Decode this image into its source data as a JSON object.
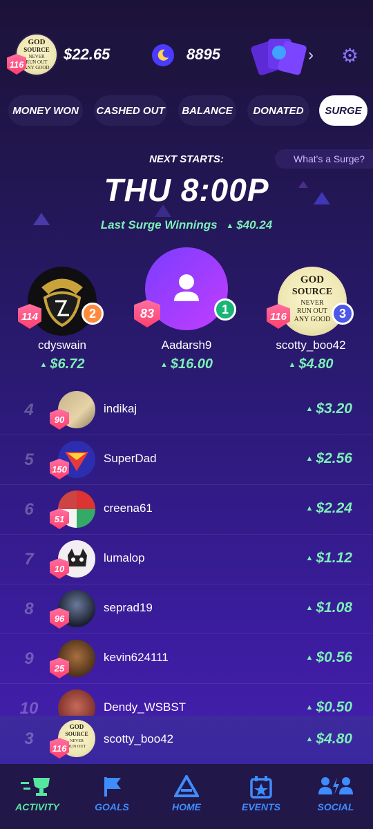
{
  "header": {
    "user_level": "116",
    "balance": "$22.65",
    "coins": "8895"
  },
  "tabs": [
    {
      "label": "MONEY WON",
      "active": false
    },
    {
      "label": "CASHED OUT",
      "active": false
    },
    {
      "label": "BALANCE",
      "active": false
    },
    {
      "label": "DONATED",
      "active": false
    },
    {
      "label": "SURGE",
      "active": true
    }
  ],
  "surge": {
    "help_link": "What's a Surge?",
    "next_label": "NEXT STARTS:",
    "next_time": "THU 8:00P",
    "last_label": "Last Surge Winnings",
    "last_amount": "$40.24"
  },
  "podium": [
    {
      "rank": "1",
      "name": "Aadarsh9",
      "level": "83",
      "amount": "$16.00"
    },
    {
      "rank": "2",
      "name": "cdyswain",
      "level": "114",
      "amount": "$6.72"
    },
    {
      "rank": "3",
      "name": "scotty_boo42",
      "level": "116",
      "amount": "$4.80"
    }
  ],
  "leaderboard": [
    {
      "rank": "4",
      "name": "indikaj",
      "level": "90",
      "amount": "$3.20"
    },
    {
      "rank": "5",
      "name": "SuperDad",
      "level": "150",
      "amount": "$2.56"
    },
    {
      "rank": "6",
      "name": "creena61",
      "level": "51",
      "amount": "$2.24"
    },
    {
      "rank": "7",
      "name": "lumalop",
      "level": "10",
      "amount": "$1.12"
    },
    {
      "rank": "8",
      "name": "seprad19",
      "level": "96",
      "amount": "$1.08"
    },
    {
      "rank": "9",
      "name": "kevin624111",
      "level": "25",
      "amount": "$0.56"
    },
    {
      "rank": "10",
      "name": "Dendy_WSBST",
      "level": "",
      "amount": "$0.50"
    }
  ],
  "pinned_self": {
    "rank": "3",
    "name": "scotty_boo42",
    "level": "116",
    "amount": "$4.80"
  },
  "nav": [
    {
      "label": "ACTIVITY",
      "icon": "trophy-icon",
      "active": true
    },
    {
      "label": "GOALS",
      "icon": "flag-icon",
      "active": false
    },
    {
      "label": "HOME",
      "icon": "home-icon",
      "active": false
    },
    {
      "label": "EVENTS",
      "icon": "calendar-star-icon",
      "active": false
    },
    {
      "label": "SOCIAL",
      "icon": "people-icon",
      "active": false
    }
  ],
  "colors": {
    "accent_green": "#7cf0b6",
    "nav_blue": "#3f8cff",
    "level_pink": "#ff4f7e"
  }
}
